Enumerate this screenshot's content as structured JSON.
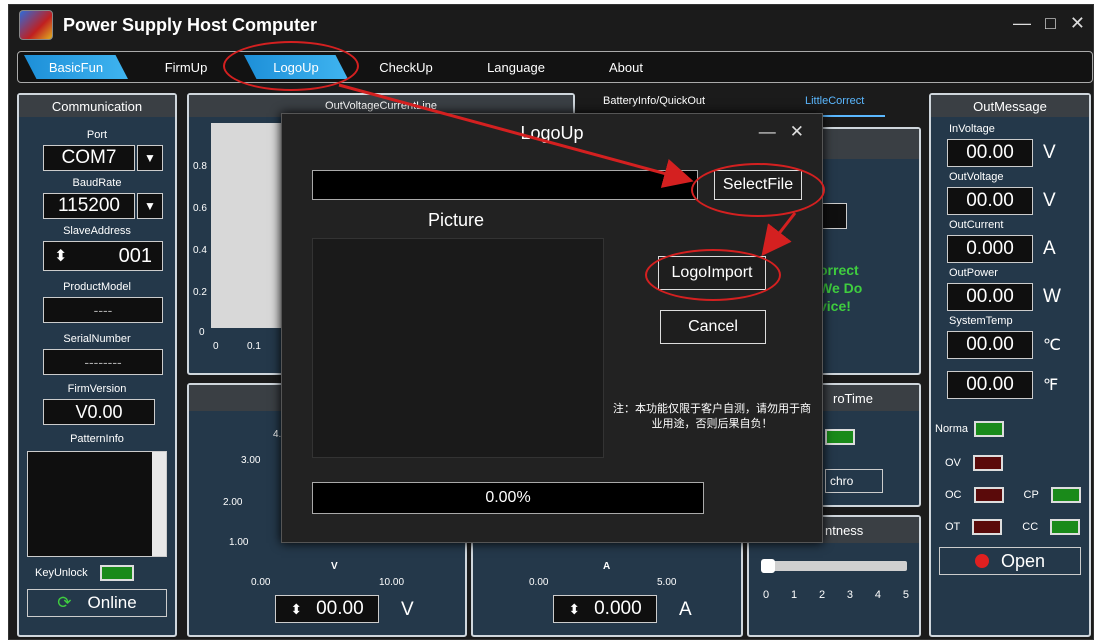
{
  "app": {
    "title": "Power Supply Host Computer",
    "controls": [
      "—",
      "□",
      "✕"
    ]
  },
  "tabs": [
    "BasicFun",
    "FirmUp",
    "LogoUp",
    "CheckUp",
    "Language",
    "About"
  ],
  "communication": {
    "title": "Communication",
    "port_label": "Port",
    "port_value": "COM7",
    "baud_label": "BaudRate",
    "baud_value": "115200",
    "slave_label": "SlaveAddress",
    "slave_value": "001",
    "model_label": "ProductModel",
    "model_value": "----",
    "serial_label": "SerialNumber",
    "serial_value": "--------",
    "firm_label": "FirmVersion",
    "firm_value": "V0.00",
    "pattern_label": "PatternInfo",
    "keyunlock_label": "KeyUnlock",
    "online_label": "Online"
  },
  "chart": {
    "title": "OutVoltageCurrentLine",
    "y_ticks": [
      "0.8",
      "0.6",
      "0.4",
      "0.2",
      "0"
    ],
    "x_ticks": [
      "0",
      "0.1"
    ]
  },
  "right_tabs": {
    "battery": "BatteryInfo/QuickOut",
    "correct": "LittleCorrect"
  },
  "partial": {
    "correct_lines": [
      "orrect",
      "We Do",
      "vice!"
    ],
    "synchro_title": "roTime",
    "synchro_btn": "chro",
    "brightness_title": "ntness",
    "brightness_ticks": [
      "0",
      "1",
      "2",
      "3",
      "4",
      "5"
    ]
  },
  "gauges": {
    "v": {
      "ticks": [
        "4.",
        "3.00",
        "2.00",
        "1.00",
        "0.00",
        "10.00"
      ],
      "unit": "V",
      "value": "00.00"
    },
    "a": {
      "ticks": [
        "0.00",
        "5.00"
      ],
      "unit": "A",
      "value": "0.000"
    }
  },
  "outmessage": {
    "title": "OutMessage",
    "in_voltage_label": "InVoltage",
    "in_voltage": "00.00",
    "in_voltage_unit": "V",
    "out_voltage_label": "OutVoltage",
    "out_voltage": "00.00",
    "out_voltage_unit": "V",
    "out_current_label": "OutCurrent",
    "out_current": "0.000",
    "out_current_unit": "A",
    "out_power_label": "OutPower",
    "out_power": "00.00",
    "out_power_unit": "W",
    "temp_label": "SystemTemp",
    "temp_c": "00.00",
    "temp_c_unit": "℃",
    "temp_f": "00.00",
    "temp_f_unit": "℉",
    "norma_label": "Norma",
    "ov_label": "OV",
    "oc_label": "OC",
    "cp_label": "CP",
    "ot_label": "OT",
    "cc_label": "CC",
    "open_label": "Open"
  },
  "dialog": {
    "title": "LogoUp",
    "controls": [
      "—",
      "✕"
    ],
    "file_path": "",
    "select_label": "SelectFile",
    "picture_label": "Picture",
    "import_label": "LogoImport",
    "cancel_label": "Cancel",
    "notice": "注：本功能仅限于客户自测，请勿用于商业用途，否则后果自负！",
    "progress_text": "0.00%",
    "progress": 0
  },
  "colors": {
    "accent": "#1d8fd8",
    "annotation": "#d42020",
    "panel_bg": "#24384a"
  }
}
